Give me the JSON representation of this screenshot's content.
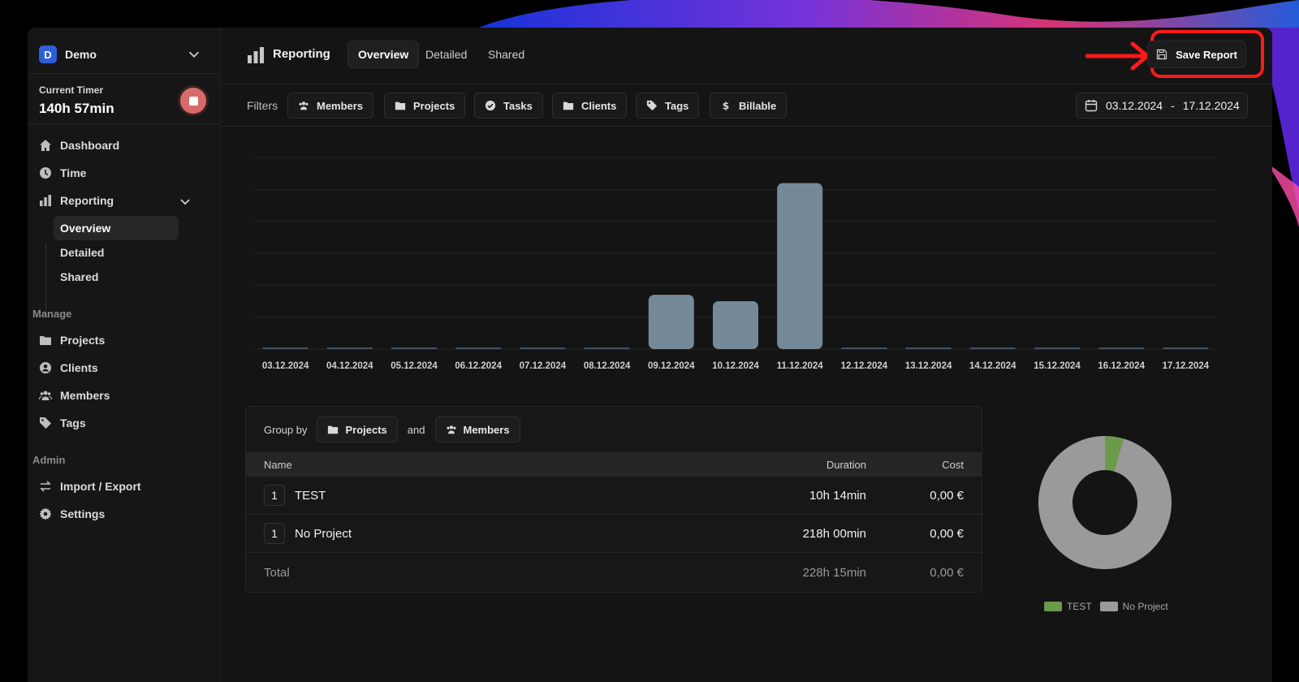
{
  "workspace": {
    "badge": "D",
    "name": "Demo"
  },
  "timer": {
    "label": "Current Timer",
    "value": "140h 57min"
  },
  "nav": {
    "dashboard": "Dashboard",
    "time": "Time",
    "reporting": "Reporting",
    "reporting_sub": [
      "Overview",
      "Detailed",
      "Shared"
    ],
    "manage_label": "Manage",
    "projects": "Projects",
    "clients": "Clients",
    "members": "Members",
    "tags": "Tags",
    "admin_label": "Admin",
    "import_export": "Import / Export",
    "settings": "Settings"
  },
  "header": {
    "title": "Reporting",
    "tabs": [
      "Overview",
      "Detailed",
      "Shared"
    ],
    "save_label": "Save Report"
  },
  "filters": {
    "label": "Filters",
    "buttons": [
      "Members",
      "Projects",
      "Tasks",
      "Clients",
      "Tags",
      "Billable"
    ],
    "date_start": "03.12.2024",
    "date_sep": "-",
    "date_end": "17.12.2024"
  },
  "chart_data": [
    {
      "type": "bar",
      "categories": [
        "03.12.2024",
        "04.12.2024",
        "05.12.2024",
        "06.12.2024",
        "07.12.2024",
        "08.12.2024",
        "09.12.2024",
        "10.12.2024",
        "11.12.2024",
        "12.12.2024",
        "13.12.2024",
        "14.12.2024",
        "15.12.2024",
        "16.12.2024",
        "17.12.2024"
      ],
      "values": [
        0,
        0,
        0,
        0,
        0,
        0,
        34,
        30,
        104,
        0,
        0,
        0,
        0,
        0,
        0
      ],
      "ylim": [
        0,
        120
      ],
      "grid": true,
      "bar_color": "#7e97a6"
    },
    {
      "type": "pie",
      "categories": [
        "TEST",
        "No Project"
      ],
      "values": [
        10.23,
        218.0
      ],
      "colors": [
        "#6a9a4a",
        "#9a9a9a"
      ],
      "legend": "bottom"
    }
  ],
  "table": {
    "groupby_label": "Group by",
    "group1": "Projects",
    "and_label": "and",
    "group2": "Members",
    "headers": {
      "name": "Name",
      "duration": "Duration",
      "cost": "Cost"
    },
    "rows": [
      {
        "count": "1",
        "name": "TEST",
        "duration": "10h 14min",
        "cost": "0,00 €"
      },
      {
        "count": "1",
        "name": "No Project",
        "duration": "218h 00min",
        "cost": "0,00 €"
      }
    ],
    "total": {
      "label": "Total",
      "duration": "228h 15min",
      "cost": "0,00 €"
    }
  },
  "colors": {
    "accent": "#2f5fd8",
    "highlight": "#ff1a1a",
    "stop": "#d96a6a"
  }
}
